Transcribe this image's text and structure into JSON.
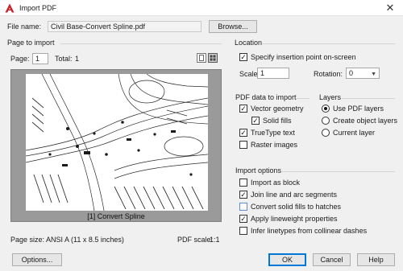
{
  "window": {
    "title": "Import PDF",
    "close_glyph": "✕"
  },
  "file": {
    "label": "File name:",
    "value": "Civil Base-Convert Spline.pdf",
    "browse_label": "Browse..."
  },
  "page_to_import": {
    "group_title": "Page to import",
    "page_label": "Page:",
    "page_value": "1",
    "total_label": "Total:",
    "total_value": "1",
    "preview_caption": "[1] Convert Spline",
    "page_size_label": "Page size:",
    "page_size_value": "ANSI A (11 x 8.5 inches)",
    "pdf_scale_label": "PDF scale:",
    "pdf_scale_value": "1:1"
  },
  "location": {
    "group_title": "Location",
    "specify_label": "Specify insertion point on-screen",
    "specify_checked": true,
    "scale_label": "Scale:",
    "scale_value": "1",
    "rotation_label": "Rotation:",
    "rotation_value": "0"
  },
  "pdf_data": {
    "group_title": "PDF data to import",
    "items": [
      {
        "label": "Vector geometry",
        "checked": true
      },
      {
        "label": "Solid fills",
        "checked": true
      },
      {
        "label": "TrueType text",
        "checked": true
      },
      {
        "label": "Raster images",
        "checked": false
      }
    ]
  },
  "layers": {
    "group_title": "Layers",
    "items": [
      {
        "label": "Use PDF layers",
        "selected": true
      },
      {
        "label": "Create object layers",
        "selected": false
      },
      {
        "label": "Current layer",
        "selected": false
      }
    ]
  },
  "import_options": {
    "group_title": "Import options",
    "items": [
      {
        "label": "Import as block",
        "checked": false
      },
      {
        "label": "Join line and arc segments",
        "checked": true
      },
      {
        "label": "Convert solid fills to hatches",
        "checked": false
      },
      {
        "label": "Apply lineweight properties",
        "checked": true
      },
      {
        "label": "Infer linetypes from collinear dashes",
        "checked": false
      }
    ]
  },
  "buttons": {
    "options": "Options...",
    "ok": "OK",
    "cancel": "Cancel",
    "help": "Help"
  },
  "colors": {
    "accent": "#0078d7",
    "app_icon": "#c8202a",
    "preview_bg": "#9a9a9a"
  },
  "icons": [
    "autocad-app-icon",
    "close-icon",
    "single-page-view-icon",
    "thumbnail-grid-view-icon",
    "chevron-down-icon"
  ]
}
